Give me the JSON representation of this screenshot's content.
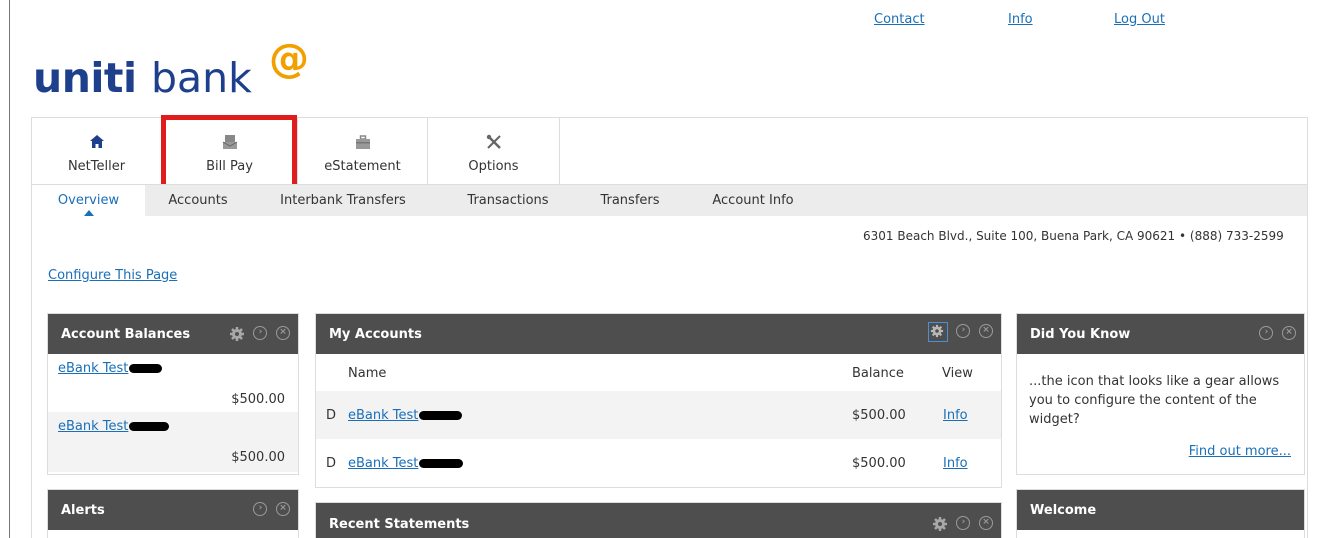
{
  "top_links": {
    "contact": "Contact",
    "info": "Info",
    "logout": "Log Out"
  },
  "brand": {
    "bold": "uniti",
    "light": "bank",
    "mark": "@"
  },
  "main_tabs": [
    {
      "label": "NetTeller",
      "icon": "home-icon"
    },
    {
      "label": "Bill Pay",
      "icon": "bill-pay-icon"
    },
    {
      "label": "eStatement",
      "icon": "briefcase-icon"
    },
    {
      "label": "Options",
      "icon": "tools-icon"
    }
  ],
  "sub_tabs": [
    "Overview",
    "Accounts",
    "Interbank Transfers",
    "Transactions",
    "Transfers",
    "Account Info"
  ],
  "address": "6301 Beach Blvd., Suite 100, Buena Park, CA 90621 • (888) 733-2599",
  "configure_link": "Configure This Page",
  "account_balances": {
    "title": "Account Balances",
    "rows": [
      {
        "name": "eBank Test",
        "amount": "$500.00"
      },
      {
        "name": "eBank Test",
        "amount": "$500.00"
      }
    ]
  },
  "my_accounts": {
    "title": "My Accounts",
    "columns": {
      "name": "Name",
      "balance": "Balance",
      "view": "View"
    },
    "rows": [
      {
        "type": "D",
        "name": "eBank Test",
        "balance": "$500.00",
        "view": "Info"
      },
      {
        "type": "D",
        "name": "eBank Test",
        "balance": "$500.00",
        "view": "Info"
      }
    ]
  },
  "did_you_know": {
    "title": "Did You Know",
    "text": "...the icon that looks like a gear allows you to configure the content of the widget?",
    "link": "Find out more..."
  },
  "alerts": {
    "title": "Alerts"
  },
  "recent_statements": {
    "title": "Recent Statements"
  },
  "welcome": {
    "title": "Welcome"
  },
  "colors": {
    "accent": "#1a6fb8",
    "brand": "#1d3f8c",
    "brand_mark": "#f2a000",
    "widget_header": "#4e4e4e",
    "highlight": "#e11c1c"
  }
}
